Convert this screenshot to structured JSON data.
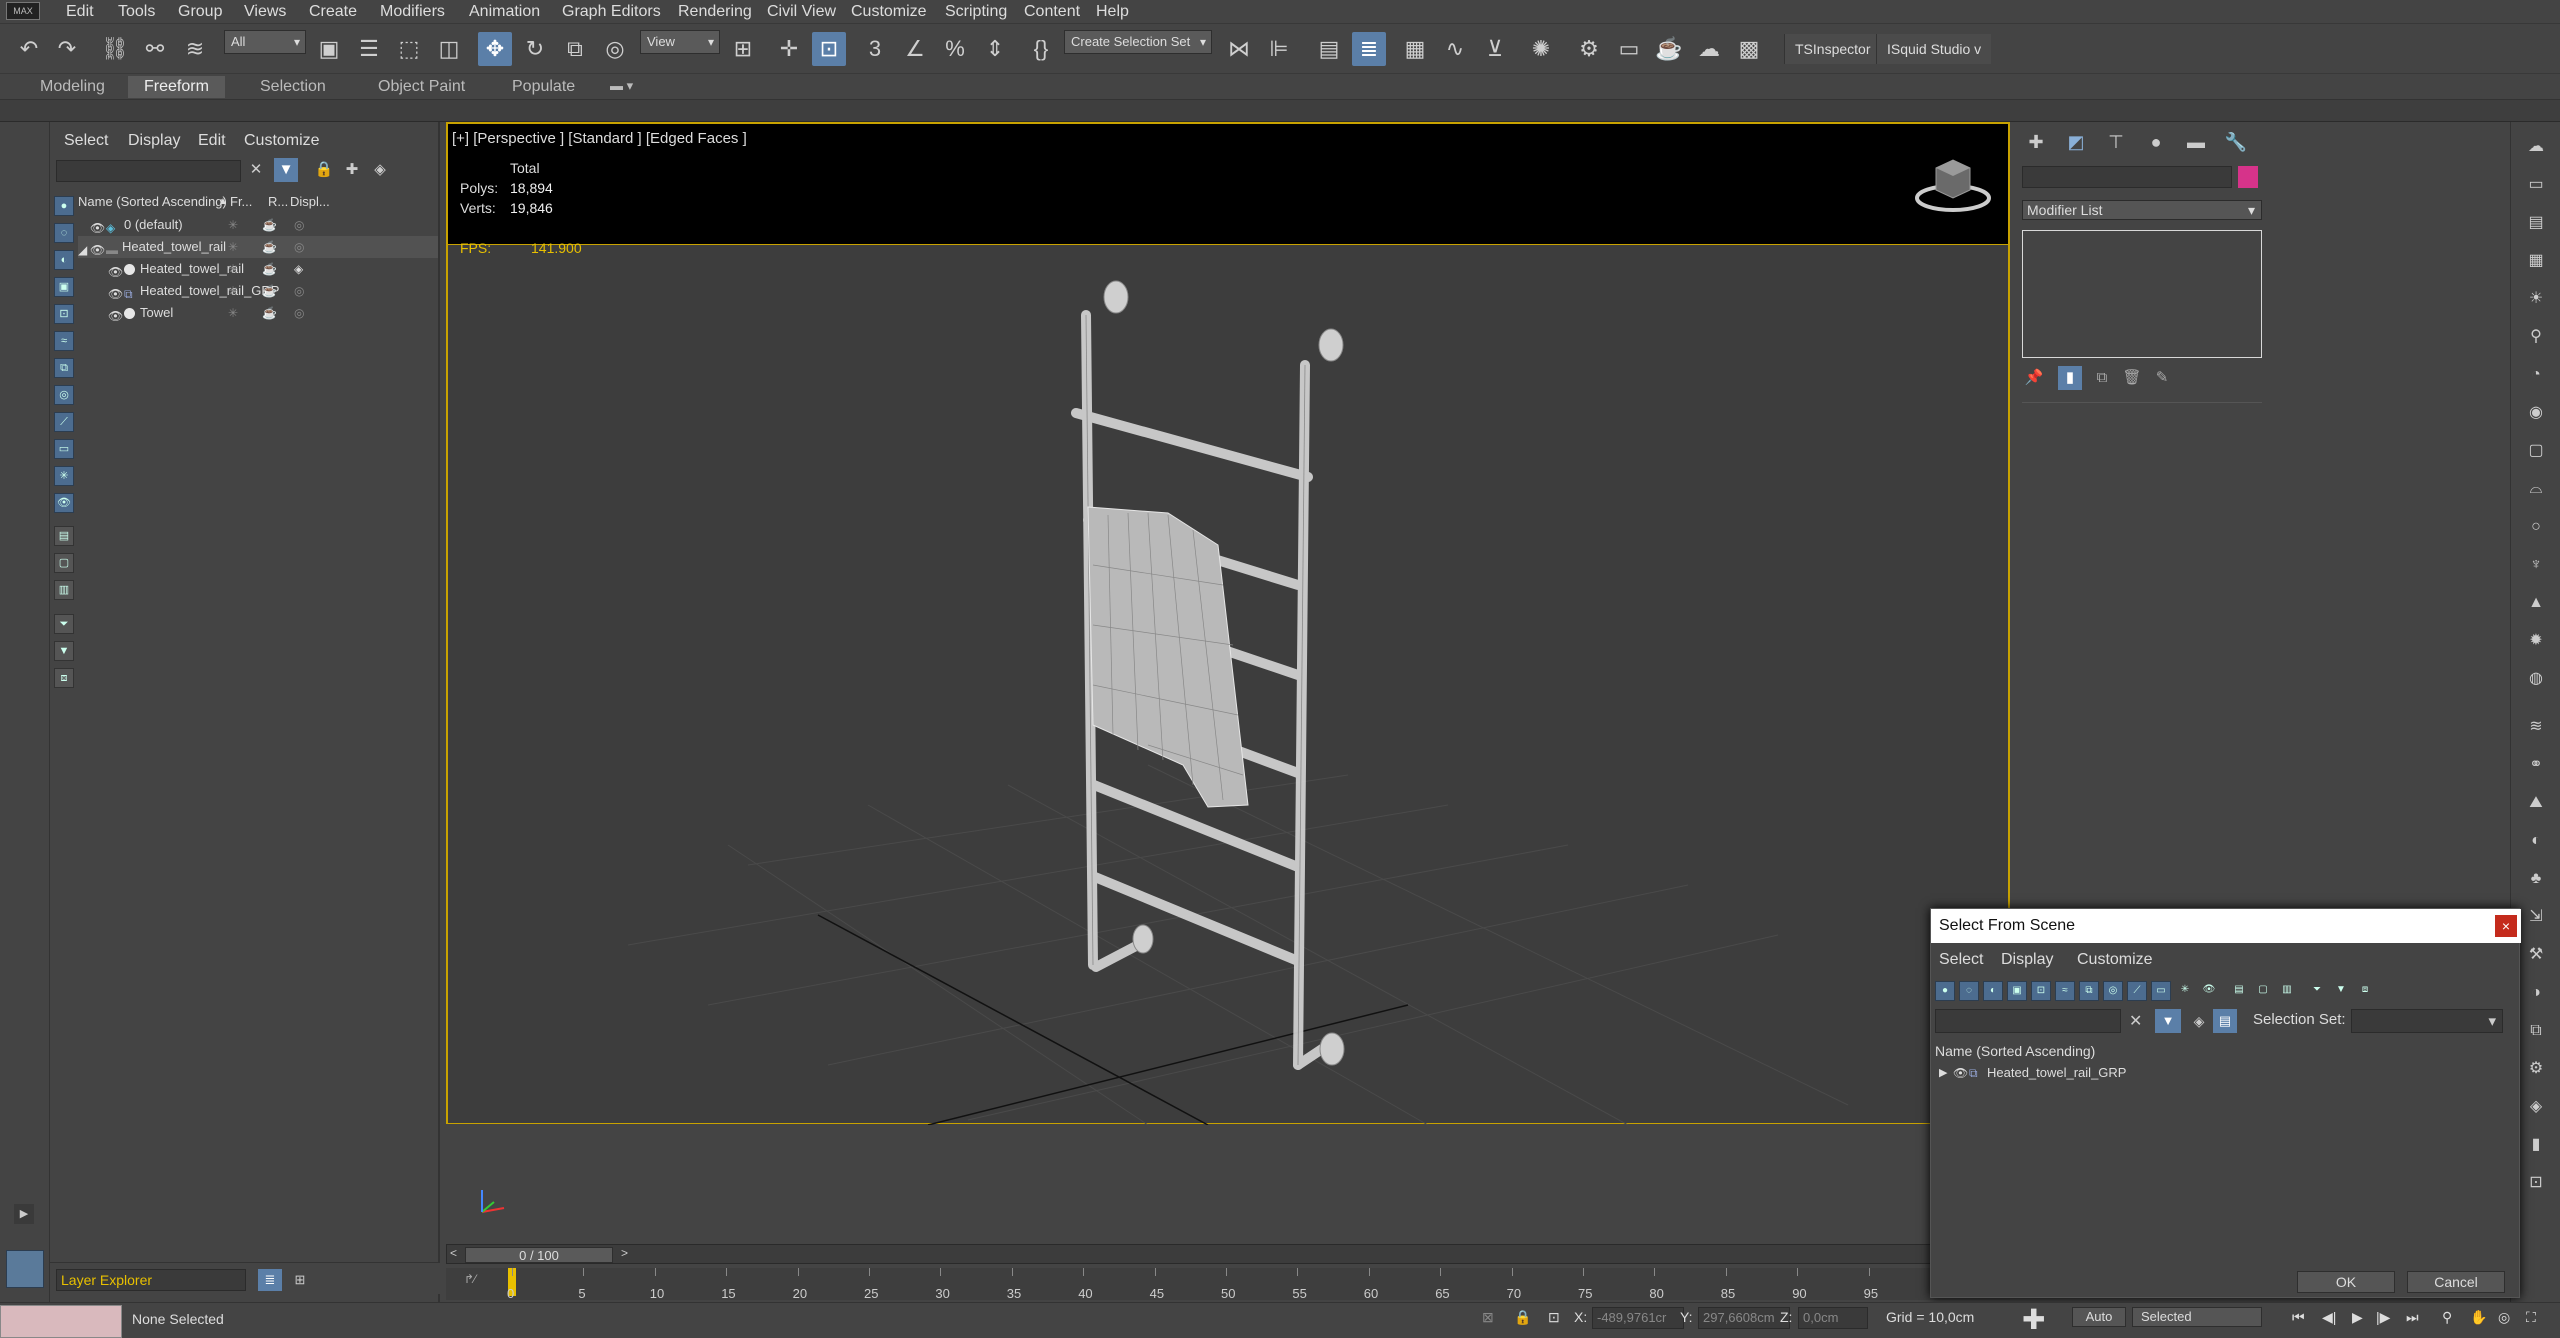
{
  "menubar": {
    "logo": "MAX",
    "items": [
      "Edit",
      "Tools",
      "Group",
      "Views",
      "Create",
      "Modifiers",
      "Animation",
      "Graph Editors",
      "Rendering",
      "Civil View",
      "Customize",
      "Scripting",
      "Content",
      "Help"
    ]
  },
  "toolbar": {
    "filter_dropdown": "All",
    "view_dropdown": "View",
    "selection_set_dropdown": "Create Selection Set",
    "ts_inspector": "TSInspector",
    "isquid": "ISquid Studio v"
  },
  "ribbon": {
    "tabs": [
      "Modeling",
      "Freeform",
      "Selection",
      "Object Paint",
      "Populate"
    ],
    "active": "Freeform"
  },
  "explorer": {
    "menus": [
      "Select",
      "Display",
      "Edit",
      "Customize"
    ],
    "columns": [
      "Name (Sorted Ascending)",
      "Fr...",
      "R...",
      "Displ..."
    ],
    "rows": [
      {
        "name": "0 (default)"
      },
      {
        "name": "Heated_towel_rail"
      },
      {
        "name": "Heated_towel_rail"
      },
      {
        "name": "Heated_towel_rail_GRP"
      },
      {
        "name": "Towel"
      }
    ],
    "layer_explorer": "Layer Explorer"
  },
  "viewport": {
    "label": "[+] [Perspective ] [Standard ] [Edged Faces ]",
    "stats": {
      "total_label": "Total",
      "polys_label": "Polys:",
      "polys": "18,894",
      "verts_label": "Verts:",
      "verts": "19,846",
      "fps_label": "FPS:",
      "fps": "141.900"
    }
  },
  "timeline": {
    "slider": "0 / 100",
    "ticks": [
      "0",
      "5",
      "10",
      "15",
      "20",
      "25",
      "30",
      "35",
      "40",
      "45",
      "50",
      "55",
      "60",
      "65",
      "70",
      "75",
      "80",
      "85",
      "90",
      "95"
    ]
  },
  "statusbar": {
    "status": "None Selected",
    "x_label": "X:",
    "x_value": "-489,9761cr",
    "y_label": "Y:",
    "y_value": "297,6608cm",
    "z_label": "Z:",
    "z_value": "0,0cm",
    "grid": "Grid = 10,0cm",
    "auto": "Auto",
    "selected": "Selected"
  },
  "command_panel": {
    "modifier_list": "Modifier List",
    "object_color": "#d6338a"
  },
  "dialog": {
    "title": "Select From Scene",
    "close": "×",
    "menus": [
      "Select",
      "Display",
      "Customize"
    ],
    "selection_set_label": "Selection Set:",
    "column": "Name (Sorted Ascending)",
    "row": "Heated_towel_rail_GRP",
    "ok": "OK",
    "cancel": "Cancel"
  }
}
